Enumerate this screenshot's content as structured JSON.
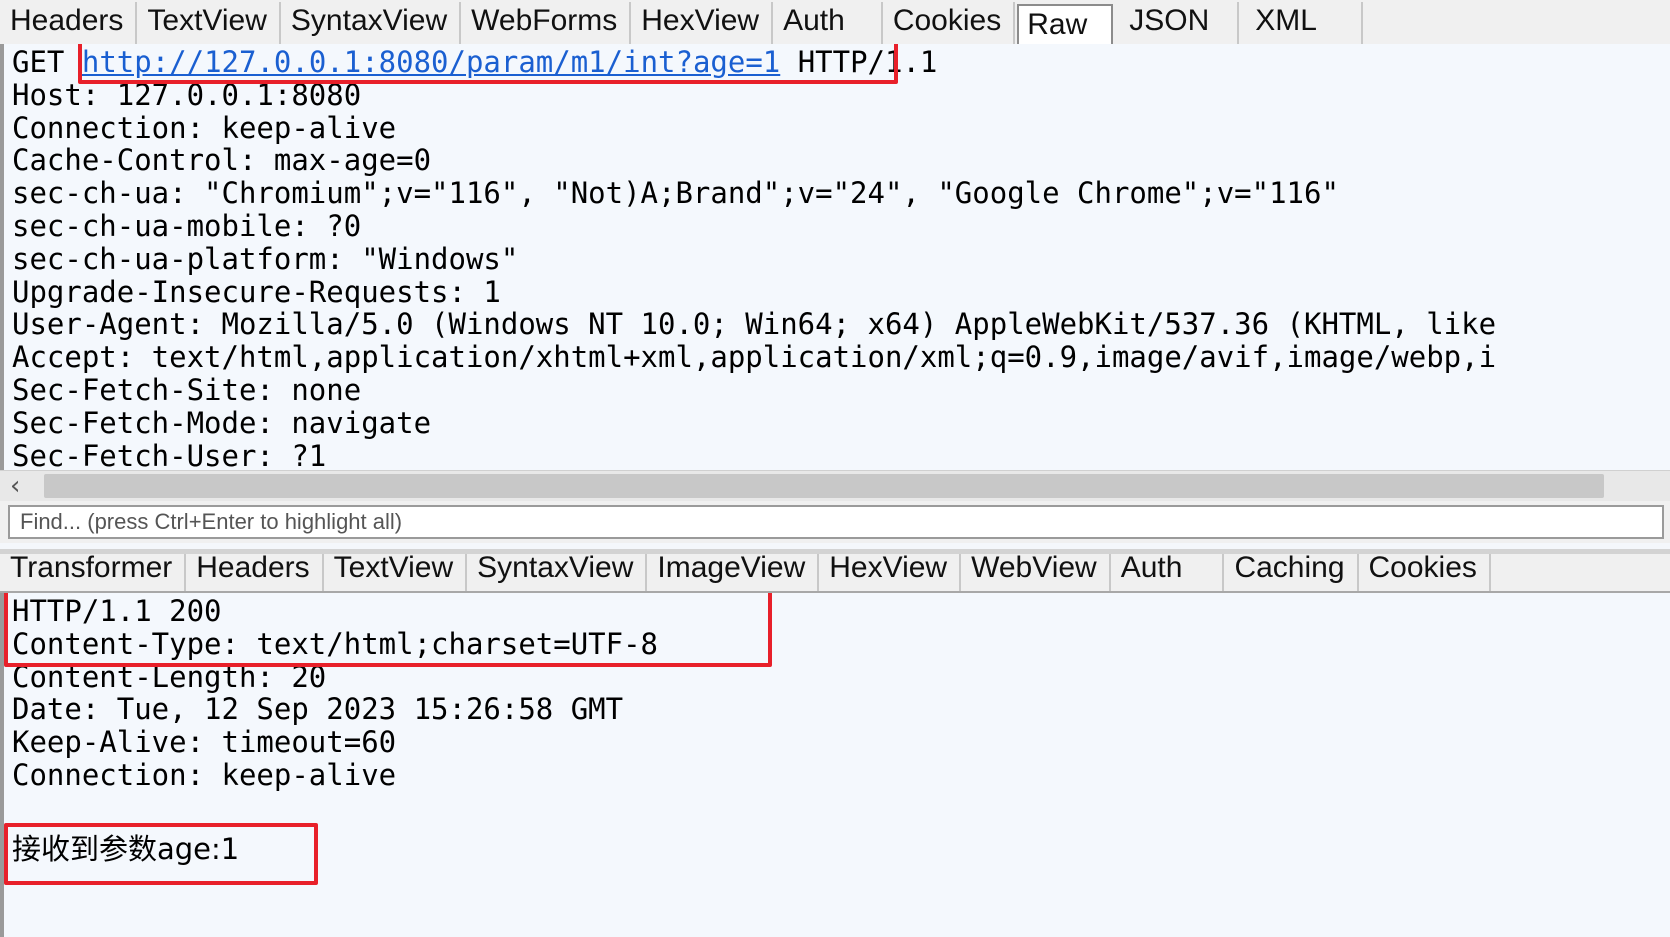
{
  "request": {
    "tabs": [
      "Headers",
      "TextView",
      "SyntaxView",
      "WebForms",
      "HexView",
      "Auth",
      "Cookies",
      "Raw",
      "JSON",
      "XML"
    ],
    "selected_tab": "Raw",
    "method": "GET",
    "url": "http://127.0.0.1:8080/param/m1/int?age=1",
    "protocol": "HTTP/1.1",
    "lines": [
      "Host: 127.0.0.1:8080",
      "Connection: keep-alive",
      "Cache-Control: max-age=0",
      "sec-ch-ua: \"Chromium\";v=\"116\", \"Not)A;Brand\";v=\"24\", \"Google Chrome\";v=\"116\"",
      "sec-ch-ua-mobile: ?0",
      "sec-ch-ua-platform: \"Windows\"",
      "Upgrade-Insecure-Requests: 1",
      "User-Agent: Mozilla/5.0 (Windows NT 10.0; Win64; x64) AppleWebKit/537.36 (KHTML, like",
      "Accept: text/html,application/xhtml+xml,application/xml;q=0.9,image/avif,image/webp,i",
      "Sec-Fetch-Site: none",
      "Sec-Fetch-Mode: navigate",
      "Sec-Fetch-User: ?1"
    ],
    "scroll_left_icon": "chevron-left-icon"
  },
  "find": {
    "placeholder": "Find... (press Ctrl+Enter to highlight all)"
  },
  "response": {
    "tabs": [
      "Transformer",
      "Headers",
      "TextView",
      "SyntaxView",
      "ImageView",
      "HexView",
      "WebView",
      "Auth",
      "Caching",
      "Cookies"
    ],
    "status_line": "HTTP/1.1 200",
    "content_type": "Content-Type: text/html;charset=UTF-8",
    "lines": [
      "Content-Length: 20",
      "Date: Tue, 12 Sep 2023 15:26:58 GMT",
      "Keep-Alive: timeout=60",
      "Connection: keep-alive"
    ],
    "body": "接收到参数age:1"
  },
  "colors": {
    "highlight_box": "#e8202a",
    "link": "#1a5fd1"
  }
}
